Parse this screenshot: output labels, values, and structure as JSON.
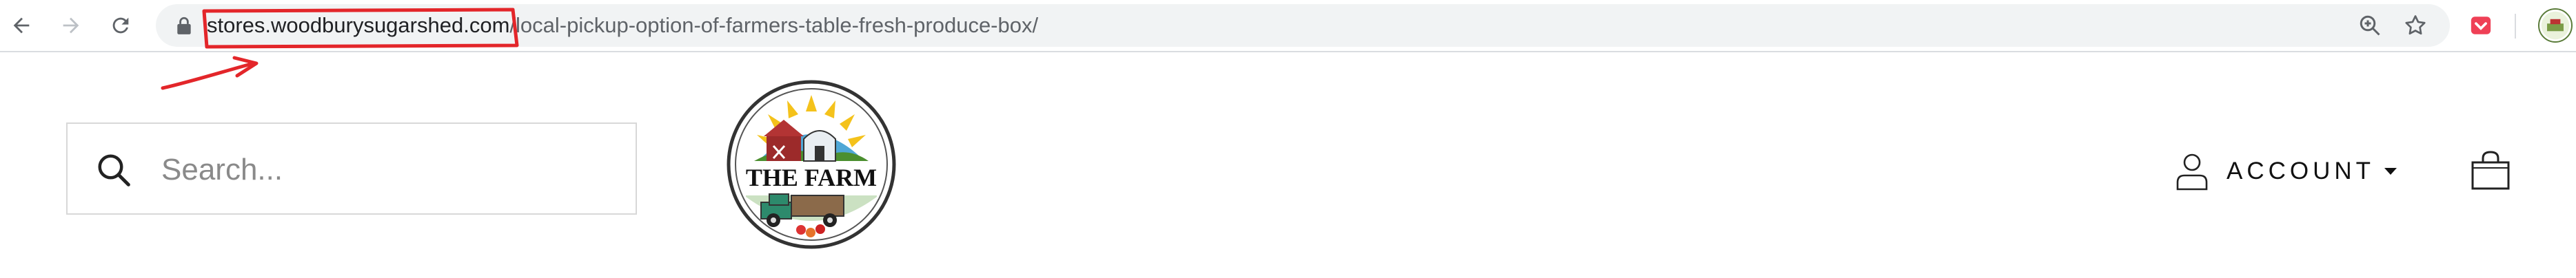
{
  "browser": {
    "url_host": "stores.woodburysugarshed.com",
    "url_path": "/local-pickup-option-of-farmers-table-fresh-produce-box/",
    "nav": {
      "back_icon": "arrow-left-icon",
      "forward_icon": "arrow-right-icon",
      "reload_icon": "reload-icon"
    },
    "omnibox_icons": [
      "lock-icon",
      "zoom-icon",
      "star-icon"
    ],
    "extensions": [
      "pocket-extension-icon"
    ],
    "profile_icon": "profile-avatar-icon",
    "annotation_color": "#e3262a"
  },
  "site": {
    "search": {
      "placeholder": "Search...",
      "value": ""
    },
    "logo": {
      "text": "THE FARM"
    },
    "account": {
      "label": "ACCOUNT"
    },
    "cart_icon": "shopping-bag-icon"
  },
  "colors": {
    "accent": "#111111",
    "chrome_bg": "#f1f3f4"
  }
}
